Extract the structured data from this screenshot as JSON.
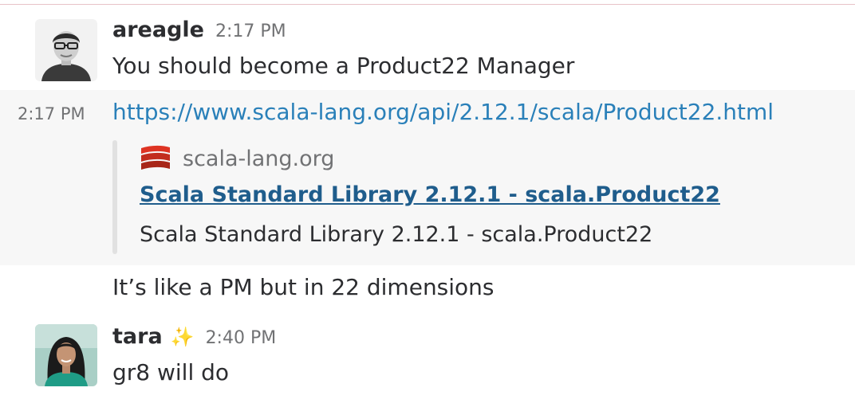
{
  "messages": [
    {
      "user": "areagle",
      "time": "2:17 PM",
      "text": "You should become a Product22 Manager"
    },
    {
      "time": "2:17 PM",
      "link": "https://www.scala-lang.org/api/2.12.1/scala/Product22.html",
      "attachment": {
        "site": "scala-lang.org",
        "title": "Scala Standard Library 2.12.1 - scala.Product22",
        "description": "Scala Standard Library 2.12.1 - scala.Product22",
        "site_icon": "scala-logo-icon"
      }
    },
    {
      "text": "It’s like a PM but in 22 dimensions"
    },
    {
      "user": "tara",
      "status_emoji": "✨",
      "time": "2:40 PM",
      "text": "gr8 will do"
    }
  ],
  "colors": {
    "link": "#2a80b9",
    "attachment_title": "#1f5d8c",
    "hover_bg": "#f7f7f7",
    "timestamp": "#717274"
  }
}
